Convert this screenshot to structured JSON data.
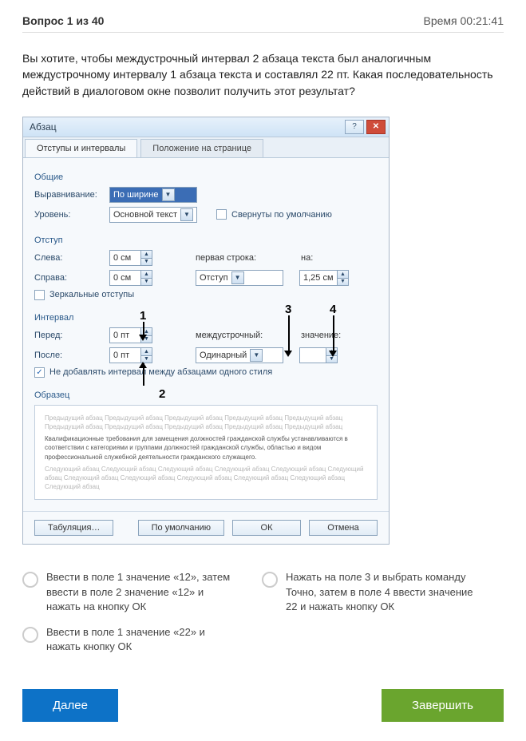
{
  "header": {
    "question_counter": "Вопрос 1 из 40",
    "time_label": "Время 00:21:41"
  },
  "question": "Вы хотите, чтобы междустрочный интервал 2 абзаца текста был аналогичным междустрочному интервалу 1 абзаца текста и составлял 22 пт. Какая последовательность действий в диалоговом окне позволит получить этот результат?",
  "dialog": {
    "title": "Абзац",
    "tabs": {
      "active": "Отступы и интервалы",
      "inactive": "Положение на странице"
    },
    "groups": {
      "general": "Общие",
      "indent": "Отступ",
      "spacing": "Интервал",
      "preview": "Образец"
    },
    "labels": {
      "alignment": "Выравнивание:",
      "level": "Уровень:",
      "left": "Слева:",
      "right": "Справа:",
      "firstline": "первая строка:",
      "by1": "на:",
      "before": "Перед:",
      "after": "После:",
      "linespacing": "междустрочный:",
      "value": "значение:"
    },
    "values": {
      "alignment": "По ширине",
      "level": "Основной текст",
      "left": "0 см",
      "right": "0 см",
      "firstline": "Отступ",
      "by1": "1,25 см",
      "before": "0 пт",
      "after": "0 пт",
      "linespacing": "Одинарный",
      "value": ""
    },
    "checkboxes": {
      "collapsed": "Свернуты по умолчанию",
      "mirror": "Зеркальные отступы",
      "dontadd": "Не добавлять интервал между абзацами одного стиля"
    },
    "buttons": {
      "tabs": "Табуляция…",
      "default": "По умолчанию",
      "ok": "ОК",
      "cancel": "Отмена"
    },
    "callouts": [
      "1",
      "2",
      "3",
      "4"
    ]
  },
  "options": [
    "Ввести в поле 1 значение «12», затем ввести в поле 2 значение «12» и нажать на кнопку ОК",
    "Нажать на поле 3 и выбрать команду Точно, затем в поле 4 ввести значение 22 и нажать кнопку ОК",
    "Ввести в поле 1 значение «22» и нажать кнопку ОК"
  ],
  "nav": {
    "next": "Далее",
    "finish": "Завершить"
  }
}
